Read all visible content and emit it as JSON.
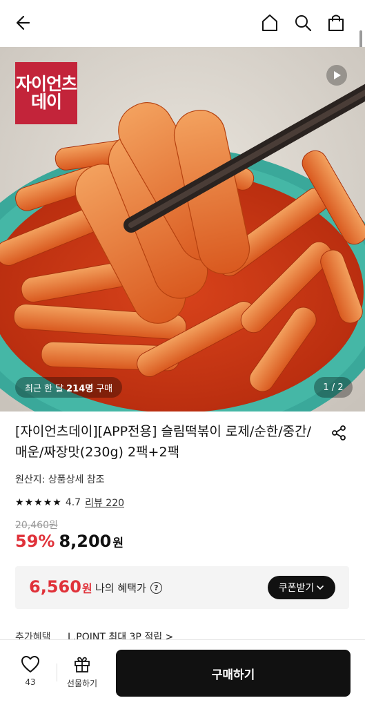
{
  "header": {
    "back_icon": "arrow-left-icon",
    "home_icon": "home-icon",
    "search_icon": "search-icon",
    "cart_icon": "shopping-bag-icon"
  },
  "hero": {
    "brand_logo_line1": "자이언츠",
    "brand_logo_line2": "데이",
    "play_icon": "play-icon",
    "purchase_prefix": "최근 한 달",
    "purchase_count": "214명",
    "purchase_suffix": "구매",
    "page_indicator": "1 / 2"
  },
  "product": {
    "title": "[자이언츠데이][APP전용] 슬림떡볶이 로제/순한/중간/매운/짜장맛(230g) 2팩+2팩",
    "share_icon": "share-icon",
    "origin": "원산지: 상품상세 참조",
    "rating_value": "4.7",
    "rating_stars": 4.7,
    "review_link": "리뷰 220",
    "original_price": "20,460원",
    "discount_rate": "59%",
    "sale_price": "8,200",
    "sale_unit": "원"
  },
  "benefit": {
    "price": "6,560",
    "unit": "원",
    "label": "나의 혜택가",
    "info_icon": "question-circle-icon",
    "coupon_button": "쿠폰받기",
    "chevron_icon": "chevron-down-icon"
  },
  "extra_benefit": {
    "label": "추가혜택",
    "value": "L.POINT 최대 3P 적립 >"
  },
  "bottom_bar": {
    "like_icon": "heart-icon",
    "like_count": "43",
    "gift_icon": "gift-icon",
    "gift_label": "선물하기",
    "buy_label": "구매하기"
  },
  "colors": {
    "accent_red": "#e0323a",
    "brand_red": "#c3243a",
    "primary_dark": "#111111"
  }
}
